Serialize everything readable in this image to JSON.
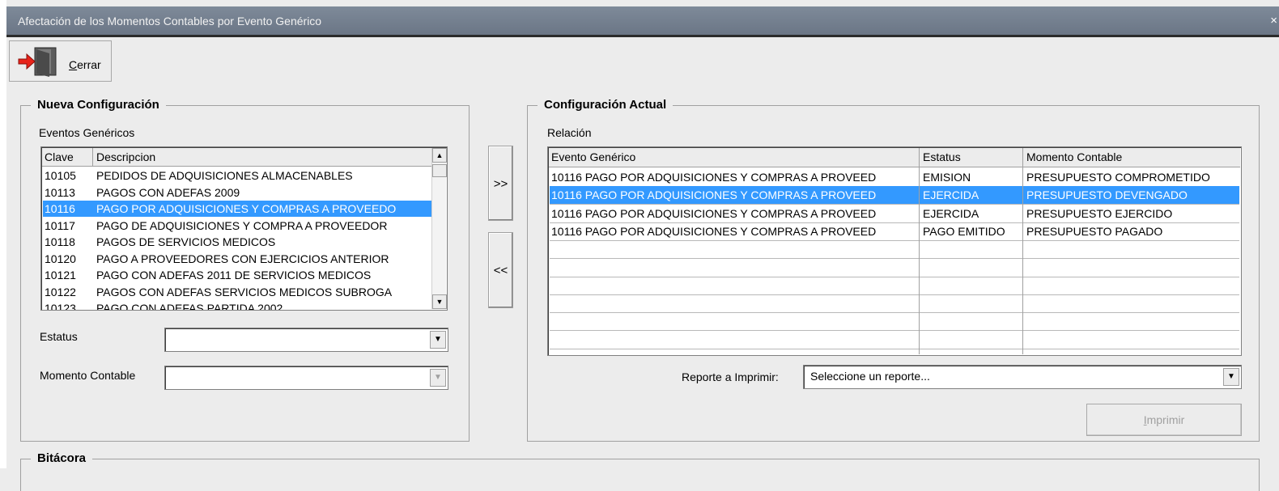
{
  "window": {
    "title": "Afectación de los Momentos Contables por Evento Genérico",
    "close_glyph": "×"
  },
  "toolbar": {
    "close_label_first": "C",
    "close_label_rest": "errar",
    "close_icon": "exit-door-icon"
  },
  "nueva": {
    "title": "Nueva Configuración",
    "eventos_label": "Eventos Genéricos",
    "columns": [
      "Clave",
      "Descripcion"
    ],
    "rows": [
      {
        "clave": "10105",
        "desc": "PEDIDOS DE ADQUISICIONES ALMACENABLES"
      },
      {
        "clave": "10113",
        "desc": "PAGOS CON ADEFAS 2009"
      },
      {
        "clave": "10116",
        "desc": "PAGO POR ADQUISICIONES Y COMPRAS A PROVEEDO"
      },
      {
        "clave": "10117",
        "desc": "PAGO DE ADQUISICIONES Y COMPRA A PROVEEDOR"
      },
      {
        "clave": "10118",
        "desc": "PAGOS DE SERVICIOS MEDICOS"
      },
      {
        "clave": "10120",
        "desc": "PAGO A PROVEEDORES CON EJERCICIOS ANTERIOR"
      },
      {
        "clave": "10121",
        "desc": "PAGO CON ADEFAS 2011 DE SERVICIOS MEDICOS"
      },
      {
        "clave": "10122",
        "desc": "PAGOS CON ADEFAS  SERVICIOS MEDICOS SUBROGA"
      },
      {
        "clave": "10123",
        "desc": "PAGO CON ADEFAS PARTIDA 2002"
      }
    ],
    "selected_row": 2,
    "estatus_label": "Estatus",
    "estatus_value": "",
    "momento_label": "Momento Contable",
    "momento_value": ""
  },
  "buttons": {
    "add": ">>",
    "remove": "<<"
  },
  "actual": {
    "title": "Configuración Actual",
    "relacion_label": "Relación",
    "columns": [
      "Evento Genérico",
      "Estatus",
      "Momento Contable"
    ],
    "rows": [
      {
        "evento": "10116 PAGO POR ADQUISICIONES Y COMPRAS A PROVEED",
        "estatus": "EMISION",
        "momento": "PRESUPUESTO COMPROMETIDO"
      },
      {
        "evento": "10116 PAGO POR ADQUISICIONES Y COMPRAS A PROVEED",
        "estatus": "EJERCIDA",
        "momento": "PRESUPUESTO DEVENGADO"
      },
      {
        "evento": "10116 PAGO POR ADQUISICIONES Y COMPRAS A PROVEED",
        "estatus": "EJERCIDA",
        "momento": "PRESUPUESTO EJERCIDO"
      },
      {
        "evento": "10116 PAGO POR ADQUISICIONES Y COMPRAS A PROVEED",
        "estatus": "PAGO EMITIDO",
        "momento": "PRESUPUESTO PAGADO"
      }
    ],
    "selected_row": 1,
    "reporte_label": "Reporte a Imprimir:",
    "reporte_value": "Seleccione un reporte...",
    "print_first": "I",
    "print_rest": "mprimir"
  },
  "bitacora": {
    "title": "Bitácora"
  },
  "colors": {
    "selection": "#3399ff",
    "titlebar": "#6b7686"
  }
}
